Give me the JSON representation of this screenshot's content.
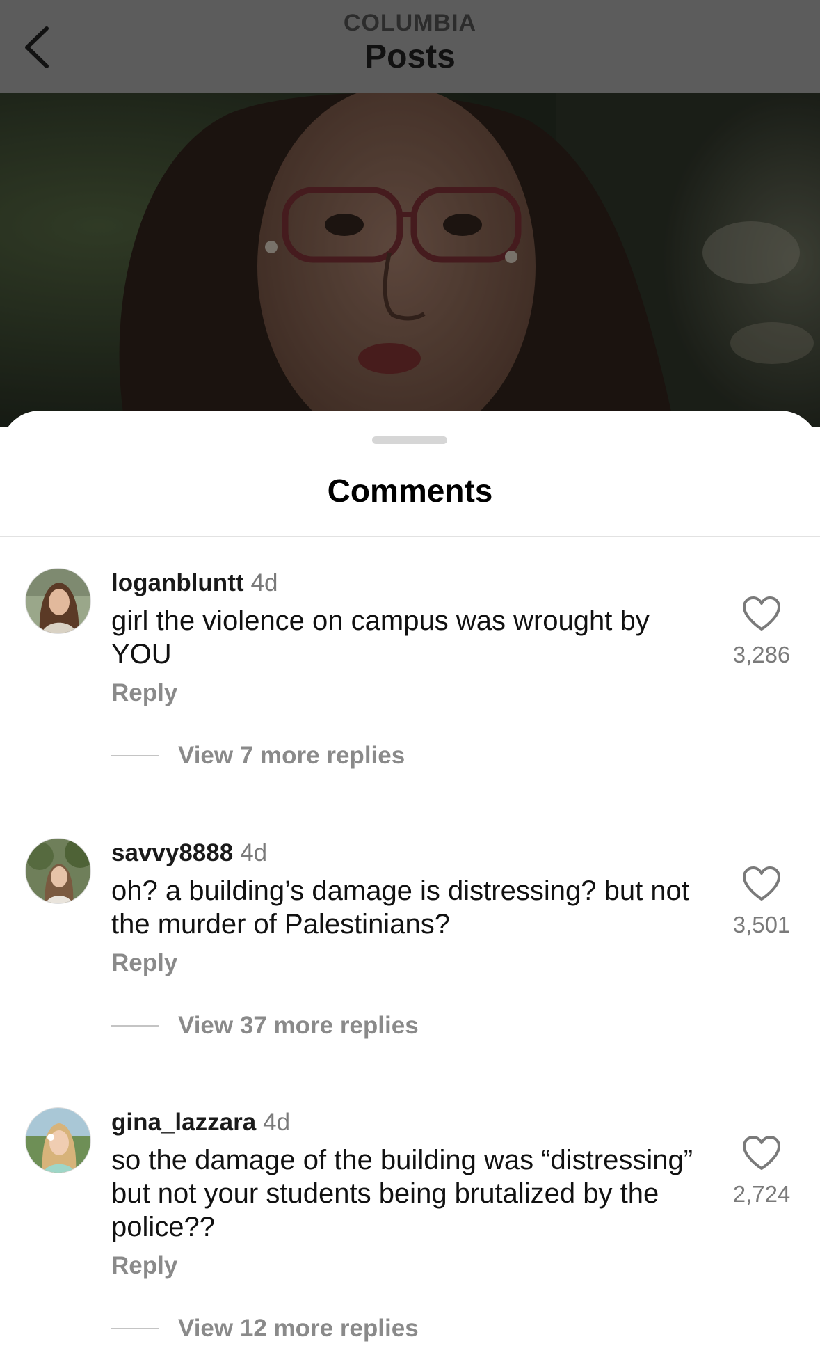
{
  "header": {
    "subtitle": "COLUMBIA",
    "title": "Posts"
  },
  "sheet": {
    "title": "Comments"
  },
  "comments": [
    {
      "username": "loganbluntt",
      "time": "4d",
      "text": "girl the violence on campus was wrought by YOU",
      "likes": "3,286",
      "reply_label": "Reply",
      "view_replies": "View 7 more replies"
    },
    {
      "username": "savvy8888",
      "time": "4d",
      "text": "oh? a building’s damage is distressing? but not the murder of Palestinians?",
      "likes": "3,501",
      "reply_label": "Reply",
      "view_replies": "View 37 more replies"
    },
    {
      "username": "gina_lazzara",
      "time": "4d",
      "text": "so the damage of the building was “distressing” but not your students being brutalized by the police??",
      "likes": "2,724",
      "reply_label": "Reply",
      "view_replies": "View 12 more replies"
    }
  ],
  "icons": {
    "back": "chevron-left-icon",
    "like": "heart-icon"
  }
}
